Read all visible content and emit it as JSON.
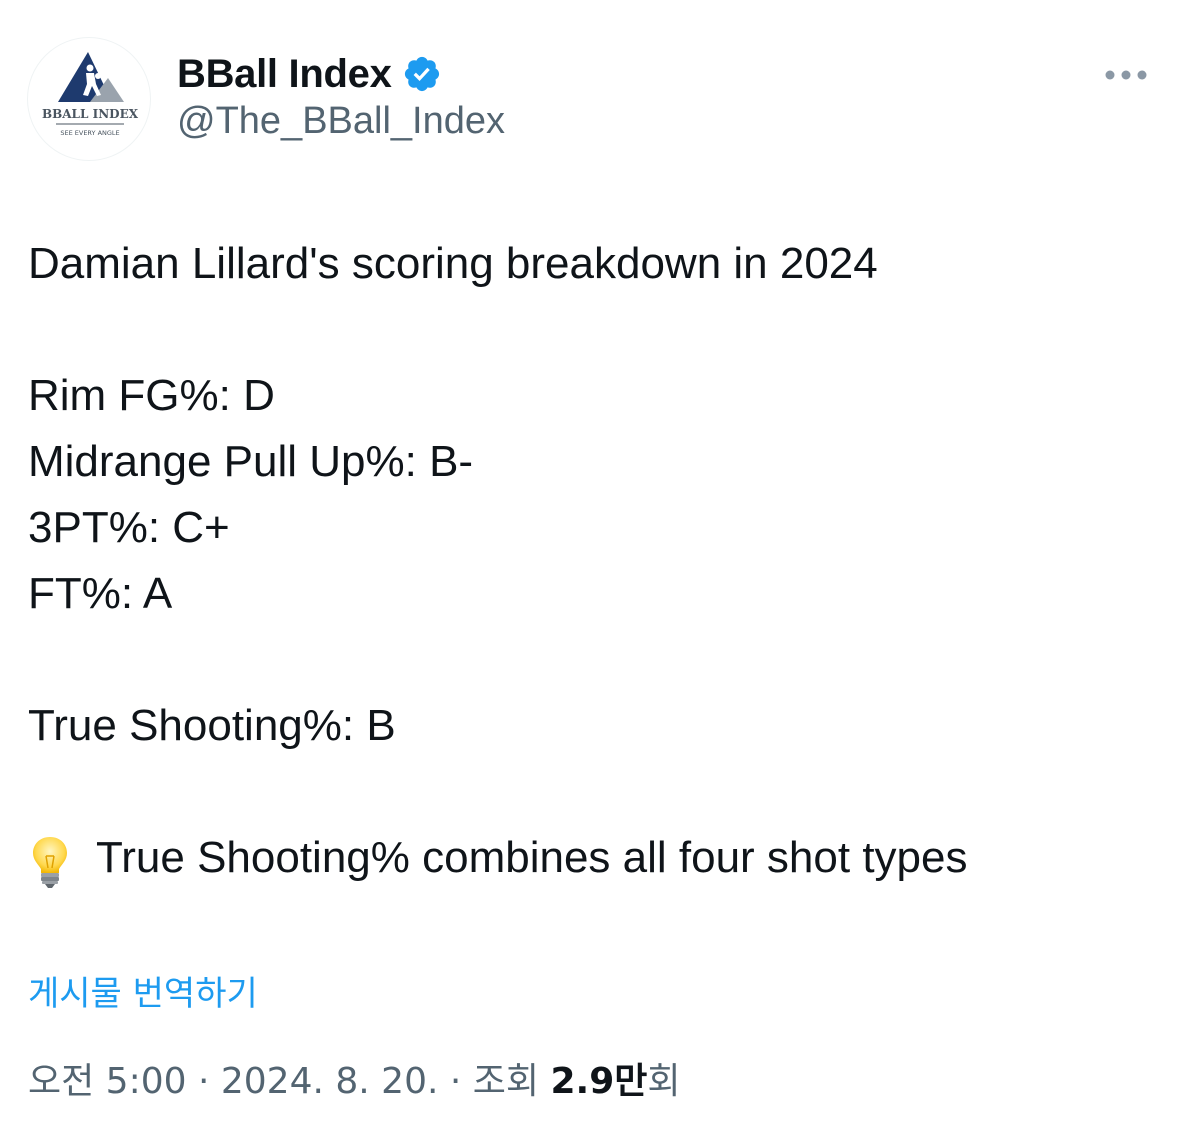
{
  "author": {
    "display_name": "BBall Index",
    "handle": "@The_BBall_Index",
    "verified": true,
    "avatar_title": "BBALL INDEX",
    "avatar_subtitle": "SEE EVERY ANGLE"
  },
  "tweet": {
    "headline": "Damian Lillard's scoring breakdown in 2024",
    "stats": [
      "Rim FG%: D",
      "Midrange Pull Up%: B-",
      "3PT%: C+",
      "FT%: A"
    ],
    "true_shooting": "True Shooting%: B",
    "tip_text": "True Shooting% combines all four shot types",
    "tip_icon": "lightbulb-icon"
  },
  "actions": {
    "translate_label": "게시물 번역하기",
    "more_icon": "more-options-icon"
  },
  "meta": {
    "time": "오전 5:00",
    "separator": " · ",
    "date": "2024. 8. 20.",
    "views_label": "조회",
    "views_count": "2.9",
    "views_unit": "만회"
  },
  "colors": {
    "verified_blue": "#1d9bf0",
    "link_blue": "#1d9bf0",
    "secondary_text": "#536471",
    "primary_text": "#0f1419",
    "logo_navy": "#1e3a6e"
  }
}
